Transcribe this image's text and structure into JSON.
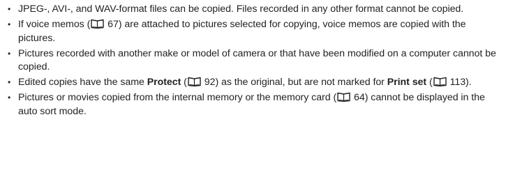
{
  "bullet_char": "•",
  "icon_name": "book-reference-icon",
  "notes": [
    {
      "text": "JPEG-, AVI-, and WAV-format files can be copied. Files recorded in any other format cannot be copied."
    },
    {
      "text_a": "If voice memos (",
      "ref": "67",
      "text_b": ") are attached to pictures selected for copying, voice memos are copied with the pictures."
    },
    {
      "text": "Pictures recorded with another make or model of camera or that have been modified on a computer cannot be copied."
    },
    {
      "text_a": "Edited copies have the same ",
      "bold_a": "Protect",
      "text_b": " (",
      "ref_a": "92",
      "text_c": ") as the original, but are not marked for ",
      "bold_b": "Print set",
      "text_d": " (",
      "ref_b": "113",
      "text_e": ")."
    },
    {
      "text_a": "Pictures or movies copied from the internal memory or the memory card (",
      "ref": "64",
      "text_b": ") cannot be displayed in the auto sort mode."
    }
  ]
}
